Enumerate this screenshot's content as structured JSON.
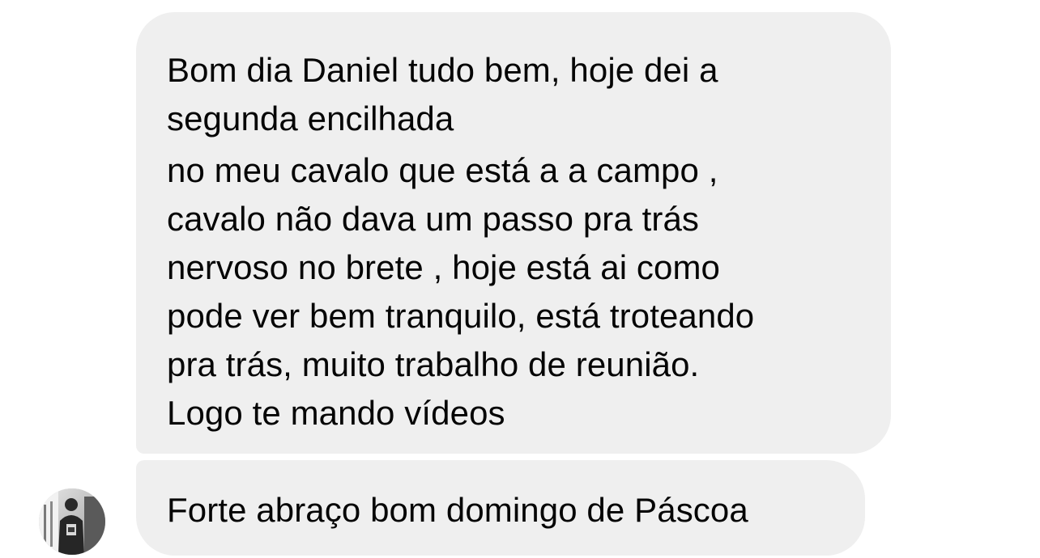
{
  "chat": {
    "messages": [
      {
        "paragraphs": [
          [
            "Bom dia Daniel tudo bem, hoje dei a",
            "segunda encilhada"
          ],
          [
            "no meu cavalo que está a a campo ,",
            "cavalo não dava um passo pra trás",
            "nervoso no brete , hoje está ai como",
            "pode ver bem tranquilo, está troteando",
            "pra trás, muito trabalho de reunião.",
            "Logo te mando vídeos"
          ]
        ]
      },
      {
        "paragraphs": [
          [
            "Forte abraço bom domingo de Páscoa"
          ]
        ]
      }
    ],
    "sender": {
      "avatar_icon": "user-avatar-photo"
    }
  },
  "colors": {
    "bubble_bg": "#efefef",
    "text": "#050505",
    "background": "#ffffff"
  }
}
